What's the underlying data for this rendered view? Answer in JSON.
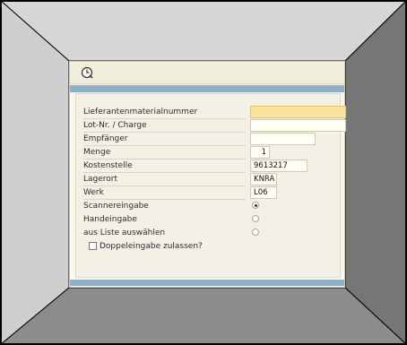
{
  "toolbar": {
    "execute_icon": "execute-clock-icon"
  },
  "form": {
    "fields": [
      {
        "label": "Lieferantenmaterialnummer",
        "value": ""
      },
      {
        "label": "Lot-Nr. / Charge",
        "value": ""
      },
      {
        "label": "Empfänger",
        "value": ""
      },
      {
        "label": "Menge",
        "value": "1"
      },
      {
        "label": "Kostenstelle",
        "value": "9613217"
      },
      {
        "label": "Lagerort",
        "value": "KNRA"
      },
      {
        "label": "Werk",
        "value": "L06"
      }
    ],
    "options": [
      {
        "label": "Scannereingabe",
        "selected": true
      },
      {
        "label": "Handeingabe",
        "selected": false
      },
      {
        "label": "aus Liste auswählen",
        "selected": false
      }
    ],
    "checkbox": {
      "label": "Doppeleingabe zulassen?",
      "checked": false
    }
  },
  "colors": {
    "required_field": "#f9e49a",
    "bar_blue": "#8fb1c8",
    "frame_light": "#d4d4d4",
    "frame_dark": "#777777"
  }
}
